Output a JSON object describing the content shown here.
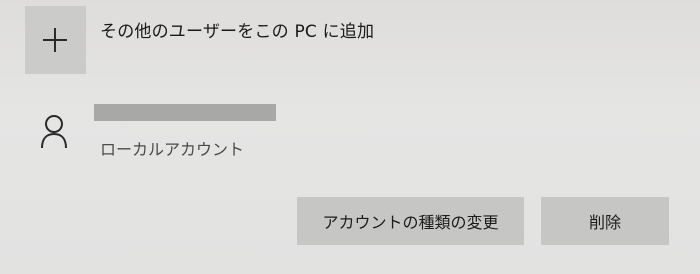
{
  "add_user": {
    "label": "その他のユーザーをこの PC に追加",
    "icon": "plus-icon"
  },
  "account": {
    "type_label": "ローカルアカウント",
    "name": "",
    "icon": "person-icon"
  },
  "actions": {
    "change_type_label": "アカウントの種類の変更",
    "delete_label": "削除"
  },
  "colors": {
    "background": "#e3e3e2",
    "tile": "#cbcbca",
    "button": "#c6c6c5",
    "redaction": "#a8a8a7"
  }
}
